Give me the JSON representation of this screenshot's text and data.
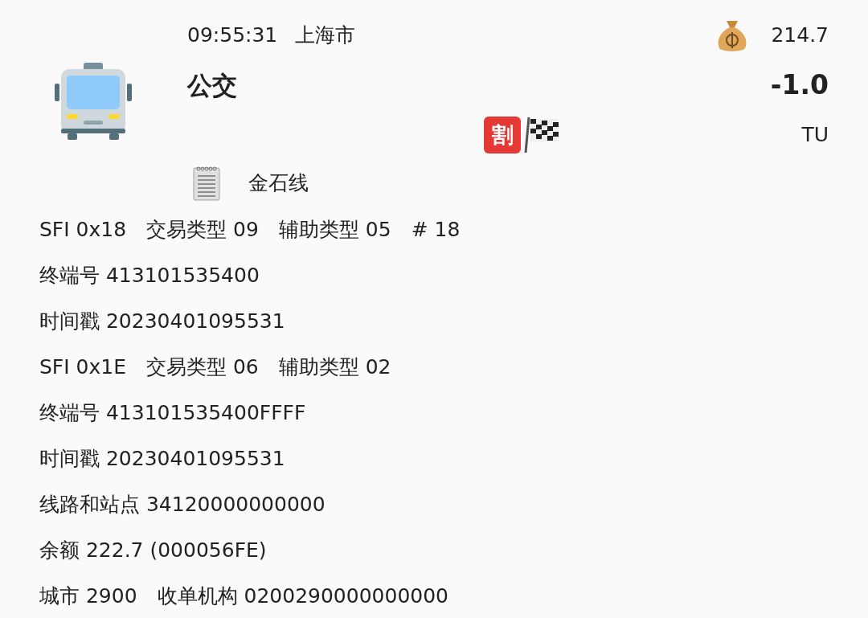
{
  "header": {
    "time": "09:55:31",
    "city": "上海市",
    "balance": "214.7",
    "title": "公交",
    "amount": "-1.0",
    "currency": "TU",
    "badge": "割",
    "line": "金石线"
  },
  "details": [
    {
      "parts": [
        "SFI 0x18",
        "交易类型 09",
        "辅助类型 05",
        "# 18"
      ]
    },
    {
      "parts": [
        "终端号 413101535400"
      ]
    },
    {
      "parts": [
        "时间戳 20230401095531"
      ]
    },
    {
      "parts": [
        "SFI 0x1E",
        "交易类型 06",
        "辅助类型 02"
      ]
    },
    {
      "parts": [
        "终端号 413101535400FFFF"
      ]
    },
    {
      "parts": [
        "时间戳 20230401095531"
      ]
    },
    {
      "parts": [
        "线路和站点 34120000000000"
      ]
    },
    {
      "parts": [
        "余额 222.7 (000056FE)"
      ]
    },
    {
      "parts": [
        "城市 2900",
        "收单机构 0200290000000000"
      ]
    }
  ]
}
